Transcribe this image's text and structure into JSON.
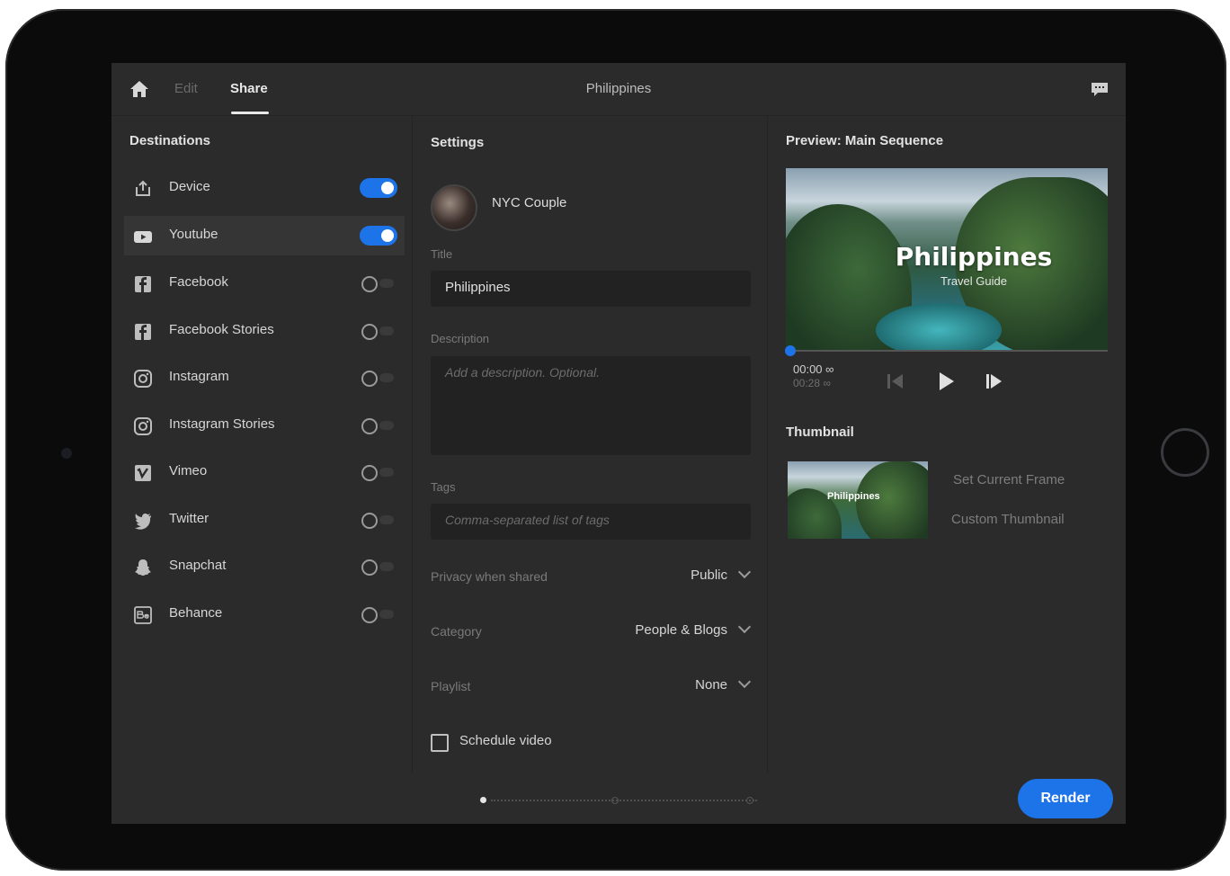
{
  "header": {
    "edit_tab": "Edit",
    "share_tab": "Share",
    "project_title": "Philippines"
  },
  "destinations": {
    "title": "Destinations",
    "items": [
      {
        "label": "Device",
        "icon": "device-export-icon",
        "enabled": true
      },
      {
        "label": "Youtube",
        "icon": "youtube-icon",
        "enabled": true
      },
      {
        "label": "Facebook",
        "icon": "facebook-icon",
        "enabled": false
      },
      {
        "label": "Facebook Stories",
        "icon": "facebook-icon",
        "enabled": false
      },
      {
        "label": "Instagram",
        "icon": "instagram-icon",
        "enabled": false
      },
      {
        "label": "Instagram Stories",
        "icon": "instagram-icon",
        "enabled": false
      },
      {
        "label": "Vimeo",
        "icon": "vimeo-icon",
        "enabled": false
      },
      {
        "label": "Twitter",
        "icon": "twitter-icon",
        "enabled": false
      },
      {
        "label": "Snapchat",
        "icon": "snapchat-icon",
        "enabled": false
      },
      {
        "label": "Behance",
        "icon": "behance-icon",
        "enabled": false
      }
    ]
  },
  "settings": {
    "title": "Settings",
    "account_name": "NYC Couple",
    "title_label": "Title",
    "title_value": "Philippines",
    "description_label": "Description",
    "description_placeholder": "Add a description. Optional.",
    "tags_label": "Tags",
    "tags_placeholder": "Comma-separated list of tags",
    "privacy_label": "Privacy when shared",
    "privacy_value": "Public",
    "category_label": "Category",
    "category_value": "People & Blogs",
    "playlist_label": "Playlist",
    "playlist_value": "None",
    "schedule_label": "Schedule video"
  },
  "preview": {
    "title": "Preview: Main Sequence",
    "video_title": "Philippines",
    "video_subtitle": "Travel Guide",
    "time_current": "00:00 ∞",
    "time_total": "00:28 ∞"
  },
  "thumbnail": {
    "title": "Thumbnail",
    "thumb_text": "Philippines",
    "set_current_frame": "Set Current Frame",
    "custom_thumbnail": "Custom Thumbnail"
  },
  "footer": {
    "render_label": "Render"
  },
  "colors": {
    "accent": "#1d73e8",
    "background": "#2b2b2b"
  }
}
